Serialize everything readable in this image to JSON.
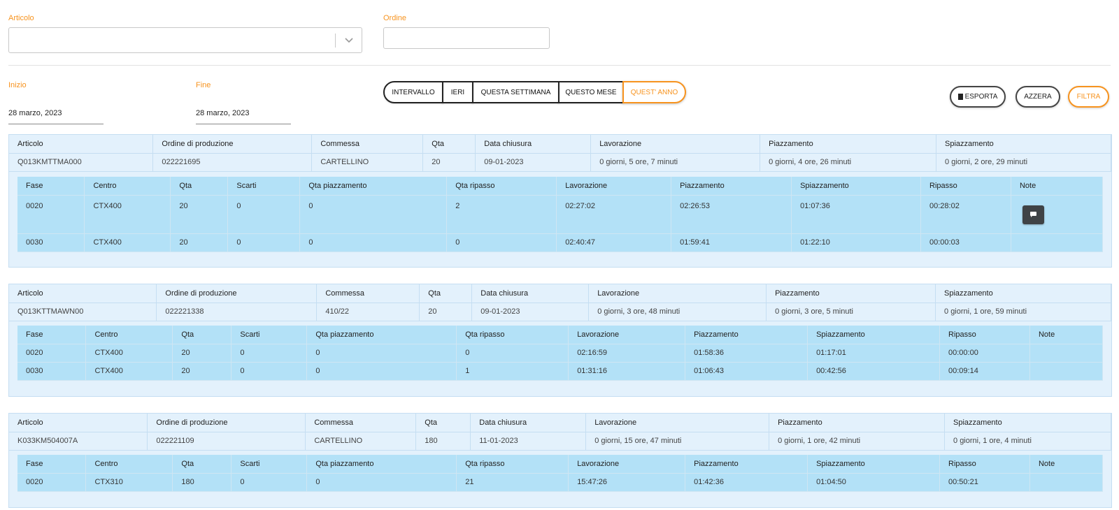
{
  "filters": {
    "articolo_label": "Articolo",
    "ordine_label": "Ordine",
    "inizio_label": "Inizio",
    "fine_label": "Fine",
    "inizio_value": "28 marzo, 2023",
    "fine_value": "28 marzo, 2023"
  },
  "period_buttons": [
    "INTERVALLO",
    "IERI",
    "QUESTA SETTIMANA",
    "QUESTO MESE",
    "QUEST' ANNO"
  ],
  "actions": {
    "export": "ESPORTA",
    "reset": "AZZERA",
    "filter": "FILTRA"
  },
  "outer_headers": [
    "Articolo",
    "Ordine di produzione",
    "Commessa",
    "Qta",
    "Data chiusura",
    "Lavorazione",
    "Piazzamento",
    "Spiazzamento"
  ],
  "inner_headers": [
    "Fase",
    "Centro",
    "Qta",
    "Scarti",
    "Qta piazzamento",
    "Qta ripasso",
    "Lavorazione",
    "Piazzamento",
    "Spiazzamento",
    "Ripasso",
    "Note"
  ],
  "orders": [
    {
      "summary": [
        "Q013KMTTMA000",
        "022221695",
        "CARTELLINO",
        "20",
        "09-01-2023",
        "0 giorni, 5 ore, 7 minuti",
        "0 giorni, 4 ore, 26 minuti",
        "0 giorni, 2 ore, 29 minuti"
      ],
      "phases": [
        [
          "0020",
          "CTX400",
          "20",
          "0",
          "0",
          "2",
          "02:27:02",
          "02:26:53",
          "01:07:36",
          "00:28:02",
          ""
        ],
        [
          "0030",
          "CTX400",
          "20",
          "0",
          "0",
          "0",
          "02:40:47",
          "01:59:41",
          "01:22:10",
          "00:00:03",
          ""
        ]
      ]
    },
    {
      "summary": [
        "Q013KTTMAWN00",
        "022221338",
        "410/22",
        "20",
        "09-01-2023",
        "0 giorni, 3 ore, 48 minuti",
        "0 giorni, 3 ore, 5 minuti",
        "0 giorni, 1 ore, 59 minuti"
      ],
      "phases": [
        [
          "0020",
          "CTX400",
          "20",
          "0",
          "0",
          "0",
          "02:16:59",
          "01:58:36",
          "01:17:01",
          "00:00:00",
          ""
        ],
        [
          "0030",
          "CTX400",
          "20",
          "0",
          "0",
          "1",
          "01:31:16",
          "01:06:43",
          "00:42:56",
          "00:09:14",
          ""
        ]
      ]
    },
    {
      "summary": [
        "K033KM504007A",
        "022221109",
        "CARTELLINO",
        "180",
        "11-01-2023",
        "0 giorni, 15 ore, 47 minuti",
        "0 giorni, 1 ore, 42 minuti",
        "0 giorni, 1 ore, 4 minuti"
      ],
      "phases": [
        [
          "0020",
          "CTX310",
          "180",
          "0",
          "0",
          "21",
          "15:47:26",
          "01:42:36",
          "01:04:50",
          "00:50:21",
          ""
        ]
      ]
    }
  ]
}
